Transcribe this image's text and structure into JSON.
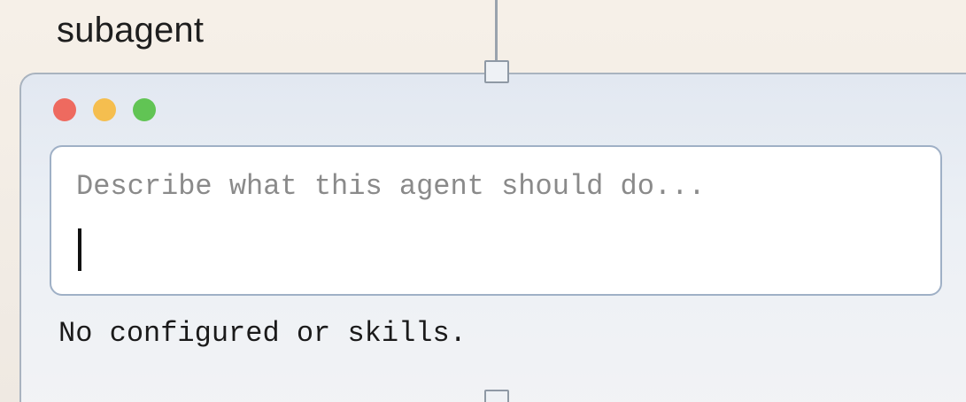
{
  "node": {
    "title": "subagent"
  },
  "window_controls": {
    "close_color": "#ee6a5f",
    "minimize_color": "#f5be4f",
    "maximize_color": "#61c454"
  },
  "prompt": {
    "placeholder": "Describe what this agent should do...",
    "value": ""
  },
  "status": {
    "text": "No configured or skills."
  }
}
